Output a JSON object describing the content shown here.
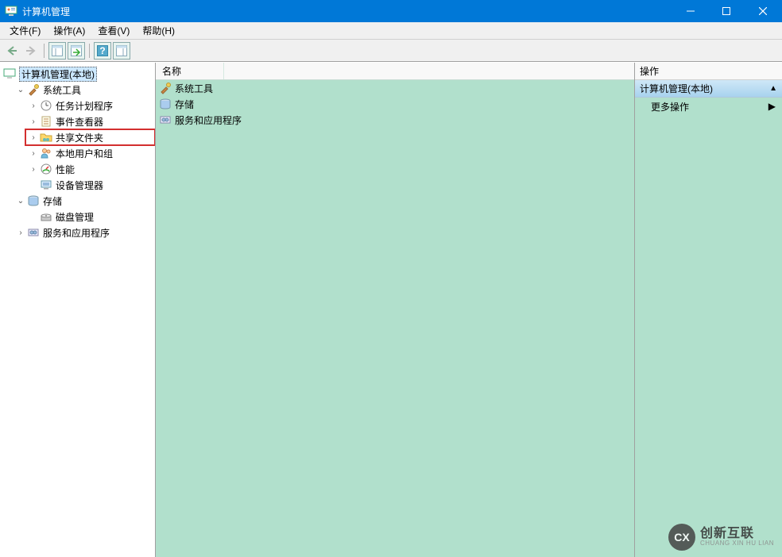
{
  "titlebar": {
    "title": "计算机管理"
  },
  "menubar": {
    "items": [
      "文件(F)",
      "操作(A)",
      "查看(V)",
      "帮助(H)"
    ]
  },
  "tree": {
    "root": {
      "label": "计算机管理(本地)"
    },
    "system_tools": {
      "label": "系统工具"
    },
    "task_scheduler": {
      "label": "任务计划程序"
    },
    "event_viewer": {
      "label": "事件查看器"
    },
    "shared_folders": {
      "label": "共享文件夹"
    },
    "local_users": {
      "label": "本地用户和组"
    },
    "performance": {
      "label": "性能"
    },
    "device_manager": {
      "label": "设备管理器"
    },
    "storage": {
      "label": "存储"
    },
    "disk_management": {
      "label": "磁盘管理"
    },
    "services_apps": {
      "label": "服务和应用程序"
    }
  },
  "center": {
    "column_header": "名称",
    "rows": [
      {
        "icon": "tools",
        "label": "系统工具"
      },
      {
        "icon": "storage",
        "label": "存储"
      },
      {
        "icon": "services",
        "label": "服务和应用程序"
      }
    ]
  },
  "actions": {
    "header": "操作",
    "section": "计算机管理(本地)",
    "more": "更多操作"
  },
  "watermark": {
    "cn": "创新互联",
    "en": "CHUANG XIN HU LIAN",
    "logo": "CX"
  }
}
